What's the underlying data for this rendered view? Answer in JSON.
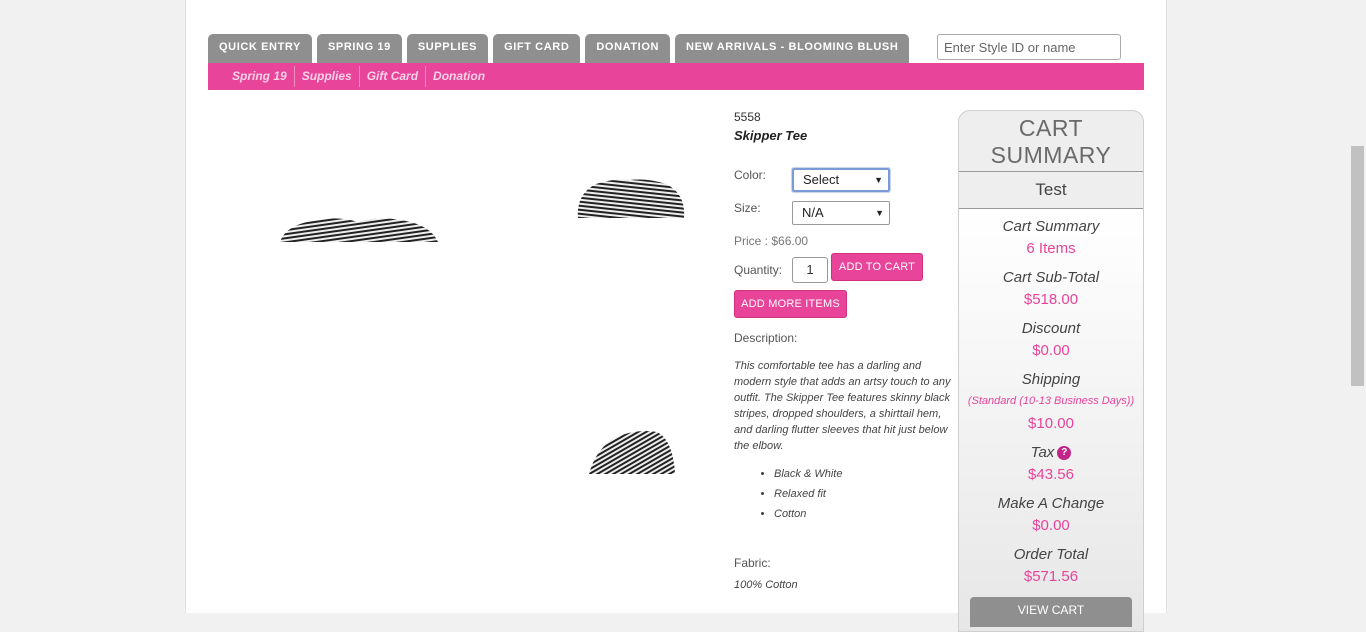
{
  "tabs": [
    {
      "label": "QUICK ENTRY"
    },
    {
      "label": "SPRING 19"
    },
    {
      "label": "SUPPLIES"
    },
    {
      "label": "GIFT CARD"
    },
    {
      "label": "DONATION"
    },
    {
      "label": "NEW ARRIVALS - BLOOMING BLUSH"
    }
  ],
  "search": {
    "placeholder": "Enter Style ID or name"
  },
  "subnav": [
    {
      "label": "Spring 19"
    },
    {
      "label": "Supplies"
    },
    {
      "label": "Gift Card"
    },
    {
      "label": "Donation"
    }
  ],
  "product": {
    "sku": "5558",
    "name": "Skipper Tee",
    "color_label": "Color:",
    "color_value": "Select",
    "size_label": "Size:",
    "size_value": "N/A",
    "price": "Price : $66.00",
    "quantity_label": "Quantity:",
    "quantity_value": "1",
    "add_to_cart": "ADD TO CART",
    "add_more": "ADD MORE ITEMS",
    "description_label": "Description:",
    "description": "This comfortable tee has a darling and modern style that adds an artsy touch to any outfit. The Skipper Tee features skinny black stripes, dropped shoulders, a shirttail hem, and darling flutter sleeves that hit just below the elbow.",
    "features": [
      "Black & White",
      "Relaxed fit",
      "Cotton"
    ],
    "fabric_label": "Fabric:",
    "fabric": "100% Cotton"
  },
  "cart": {
    "title": "CART SUMMARY",
    "user": "Test",
    "summary_label": "Cart Summary",
    "items": "6 Items",
    "subtotal_label": "Cart Sub-Total",
    "subtotal": "$518.00",
    "discount_label": "Discount",
    "discount": "$0.00",
    "shipping_label": "Shipping",
    "shipping_method": "(Standard (10-13 Business Days))",
    "shipping": "$10.00",
    "tax_label": "Tax",
    "tax": "$43.56",
    "change_label": "Make A Change",
    "change": "$0.00",
    "total_label": "Order Total",
    "total": "$571.56",
    "view_cart": "VIEW CART"
  },
  "colors": {
    "accent": "#e8449a",
    "tab": "#8f8f8f"
  }
}
